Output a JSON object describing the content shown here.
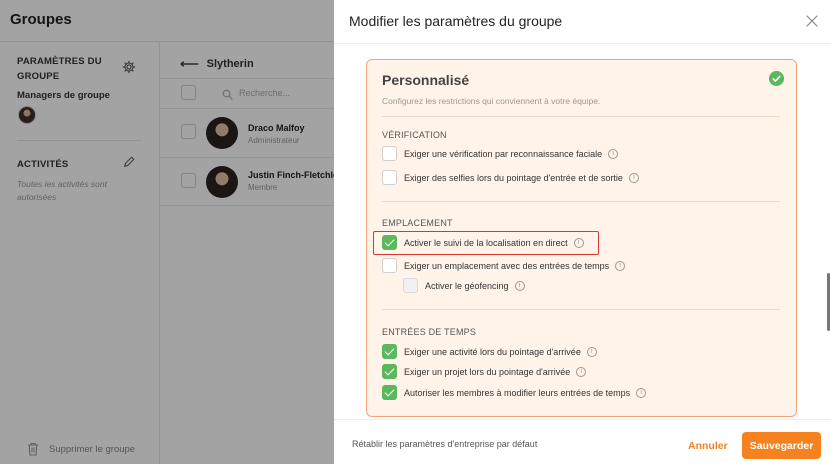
{
  "app": {
    "title": "Groupes"
  },
  "left_panel": {
    "group_settings_title": "PARAMÈTRES DU GROUPE",
    "managers_label": "Managers de groupe",
    "activities_title": "ACTIVITÉS",
    "activities_note": "Toutes les activités sont autorisées",
    "delete_group": "Supprimer le groupe"
  },
  "members_panel": {
    "group_name": "Slytherin",
    "search_placeholder": "Recherche...",
    "members": [
      {
        "name": "Draco Malfoy",
        "role": "Administrateur"
      },
      {
        "name": "Justin Finch-Fletchley",
        "role": "Membre"
      }
    ]
  },
  "modal": {
    "title": "Modifier les paramètres du groupe",
    "card": {
      "title": "Personnalisé",
      "description": "Configurez les restrictions qui conviennent à votre équipe.",
      "sections": [
        {
          "title": "VÉRIFICATION",
          "options": [
            {
              "label": "Exiger une vérification par reconnaissance faciale",
              "checked": false
            },
            {
              "label": "Exiger des selfies lors du pointage d'entrée et de sortie",
              "checked": false
            }
          ]
        },
        {
          "title": "EMPLACEMENT",
          "options": [
            {
              "label": "Activer le suivi de la localisation en direct",
              "checked": true
            },
            {
              "label": "Exiger un emplacement avec des entrées de temps",
              "checked": false
            },
            {
              "label": "Activer le géofencing",
              "checked": false
            }
          ]
        },
        {
          "title": "ENTRÉES DE TEMPS",
          "options": [
            {
              "label": "Exiger une activité lors du pointage d'arrivée",
              "checked": true
            },
            {
              "label": "Exiger un projet lors du pointage d'arrivée",
              "checked": true
            },
            {
              "label": "Autoriser les membres à modifier leurs entrées de temps",
              "checked": true
            }
          ]
        }
      ]
    },
    "footer": {
      "reset_label": "Rétablir les paramètres d'entreprise par défaut",
      "cancel_label": "Annuler",
      "save_label": "Sauvegarder"
    }
  },
  "colors": {
    "accent": "#f5821f",
    "check_green": "#5cb85c",
    "card_bg": "#fff3ea",
    "card_border": "#f3a57a",
    "highlight": "#d93636"
  },
  "icons": [
    "gear-icon",
    "pencil-icon",
    "trash-icon",
    "arrow-left-icon",
    "search-icon",
    "close-icon",
    "check-icon",
    "info-icon"
  ]
}
